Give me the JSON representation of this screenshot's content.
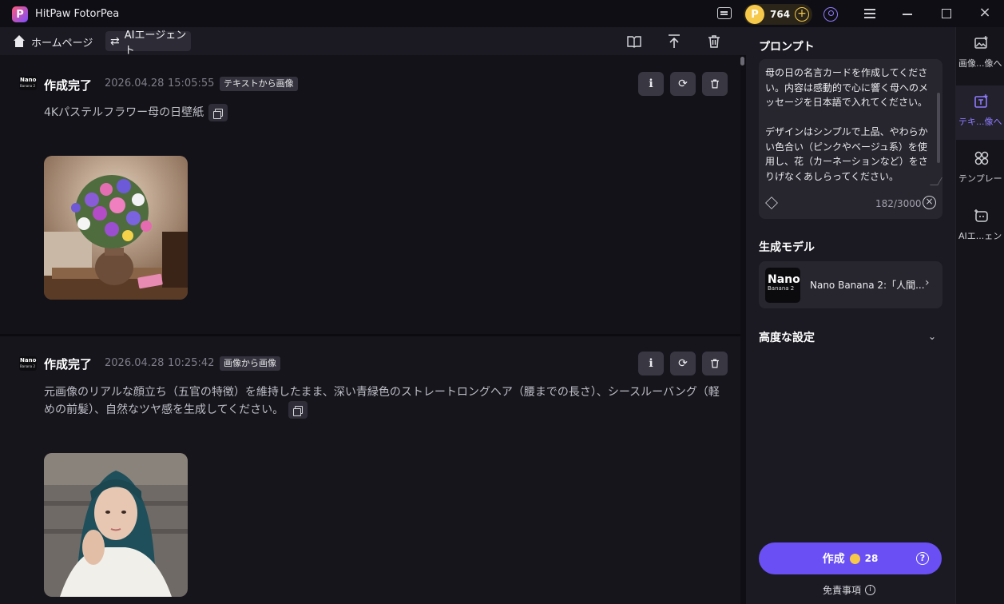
{
  "window": {
    "title": "HitPaw FotorPea",
    "coins": "764",
    "logo_letter": "P"
  },
  "toolbar": {
    "home_label": "ホームページ",
    "agent_tab": "AIエージェント"
  },
  "feed": [
    {
      "status": "作成完了",
      "date": "2026.04.28",
      "time": "15:05:55",
      "tag": "テキストから画像",
      "prompt": "4Kパステルフラワー母の日壁紙",
      "model_logo": "Nano"
    },
    {
      "status": "作成完了",
      "date": "2026.04.28",
      "time": "10:25:42",
      "tag": "画像から画像",
      "prompt": "元画像のリアルな顔立ち（五官の特徴）を維持したまま、深い青緑色のストレートロングヘア（腰までの長さ）、シースルーバング（軽めの前髪）、自然なツヤ感を生成してください。",
      "model_logo": "Nano"
    }
  ],
  "panel": {
    "prompt_heading": "プロンプト",
    "prompt_value": "母の日の名言カードを作成してください。内容は感動的で心に響く母へのメッセージを日本語で入れてください。\n\nデザインはシンプルで上品、やわらかい色合い（ピンクやベージュ系）を使用し、花（カーネーションなど）をさりげなくあしらってください。",
    "char_count": "182/3000",
    "model_heading": "生成モデル",
    "model_name": "Nano Banana 2:「人間...",
    "model_logo_line1": "Nano",
    "model_logo_line2": "Banana 2",
    "advanced_heading": "高度な設定",
    "create_label": "作成",
    "create_cost": "28",
    "disclaimer": "免責事項"
  },
  "side_nav": [
    {
      "label": "画像...像へ",
      "icon": "image-edit-icon",
      "active": false
    },
    {
      "label": "テキ...像へ",
      "icon": "text-to-image-icon",
      "active": true
    },
    {
      "label": "テンプレート",
      "icon": "template-icon",
      "active": false
    },
    {
      "label": "AIエ...ェント",
      "icon": "ai-agent-icon",
      "active": false
    }
  ],
  "colors": {
    "accent": "#6a4ff5",
    "coin": "#f7c94a",
    "background": "#0f0e14"
  }
}
